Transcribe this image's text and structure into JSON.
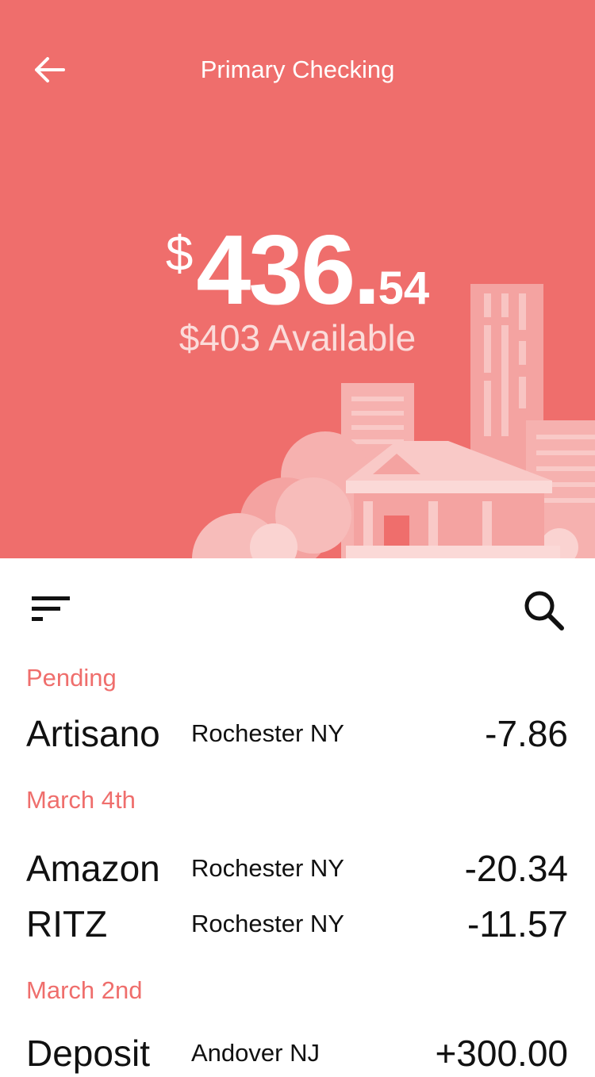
{
  "header": {
    "title": "Primary Checking",
    "balance_currency": "$",
    "balance_main": "436.",
    "balance_cents": "54",
    "available": "$403 Available"
  },
  "colors": {
    "accent": "#ef6e6c",
    "section_label": "#ef6e6c",
    "text": "#111111"
  },
  "icons": {
    "back": "arrow-left-icon",
    "filter": "sort-lines-icon",
    "search": "search-icon"
  },
  "transactions": {
    "pending_label": "Pending",
    "pending": [
      {
        "name": "Artisano",
        "location": "Rochester NY",
        "amount": "-7.86"
      }
    ],
    "march4_label": "March 4th",
    "march4": [
      {
        "name": "Amazon",
        "location": "Rochester NY",
        "amount": "-20.34"
      },
      {
        "name": "RITZ",
        "location": "Rochester NY",
        "amount": "-11.57"
      }
    ],
    "march2_label": "March 2nd",
    "march2": [
      {
        "name": "Deposit",
        "location": "Andover NJ",
        "amount": "+300.00"
      }
    ]
  }
}
